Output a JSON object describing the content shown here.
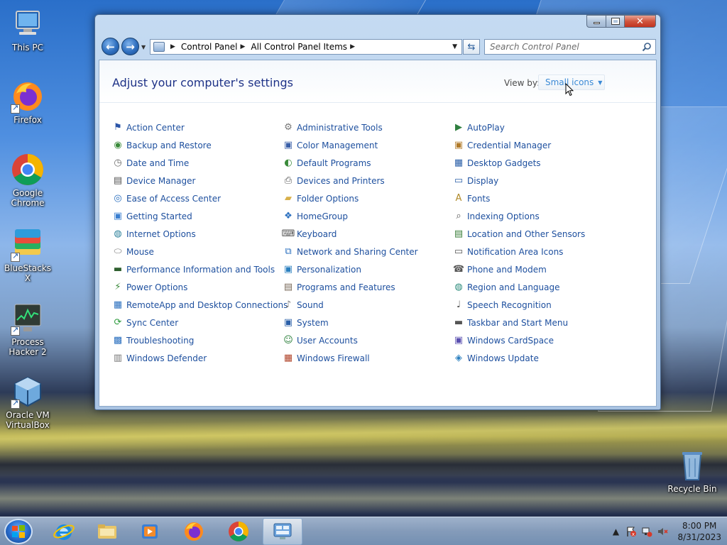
{
  "desktop": {
    "icons": [
      {
        "label": "This PC"
      },
      {
        "label": "Firefox"
      },
      {
        "label": "Google Chrome"
      },
      {
        "label": "BlueStacks X"
      },
      {
        "label": "Process Hacker 2"
      },
      {
        "label": "Oracle VM VirtualBox"
      },
      {
        "label": "Recycle Bin"
      }
    ]
  },
  "window": {
    "breadcrumb": [
      "Control Panel",
      "All Control Panel Items"
    ],
    "search_placeholder": "Search Control Panel",
    "title": "Adjust your computer's settings",
    "view_by_label": "View by:",
    "view_by_value": "Small icons",
    "columns": [
      [
        {
          "label": "Action Center",
          "icon": "flag-icon"
        },
        {
          "label": "Backup and Restore",
          "icon": "backup-icon"
        },
        {
          "label": "Date and Time",
          "icon": "clock-icon"
        },
        {
          "label": "Device Manager",
          "icon": "device-manager-icon"
        },
        {
          "label": "Ease of Access Center",
          "icon": "accessibility-icon"
        },
        {
          "label": "Getting Started",
          "icon": "getting-started-icon"
        },
        {
          "label": "Internet Options",
          "icon": "internet-icon"
        },
        {
          "label": "Mouse",
          "icon": "mouse-icon"
        },
        {
          "label": "Performance Information and Tools",
          "icon": "performance-icon"
        },
        {
          "label": "Power Options",
          "icon": "power-icon"
        },
        {
          "label": "RemoteApp and Desktop Connections",
          "icon": "remoteapp-icon"
        },
        {
          "label": "Sync Center",
          "icon": "sync-icon"
        },
        {
          "label": "Troubleshooting",
          "icon": "troubleshoot-icon"
        },
        {
          "label": "Windows Defender",
          "icon": "defender-icon"
        }
      ],
      [
        {
          "label": "Administrative Tools",
          "icon": "admin-tools-icon"
        },
        {
          "label": "Color Management",
          "icon": "color-icon"
        },
        {
          "label": "Default Programs",
          "icon": "default-programs-icon"
        },
        {
          "label": "Devices and Printers",
          "icon": "printer-icon"
        },
        {
          "label": "Folder Options",
          "icon": "folder-icon"
        },
        {
          "label": "HomeGroup",
          "icon": "homegroup-icon"
        },
        {
          "label": "Keyboard",
          "icon": "keyboard-icon"
        },
        {
          "label": "Network and Sharing Center",
          "icon": "network-icon"
        },
        {
          "label": "Personalization",
          "icon": "personalization-icon"
        },
        {
          "label": "Programs and Features",
          "icon": "programs-icon"
        },
        {
          "label": "Sound",
          "icon": "sound-icon"
        },
        {
          "label": "System",
          "icon": "system-icon"
        },
        {
          "label": "User Accounts",
          "icon": "users-icon"
        },
        {
          "label": "Windows Firewall",
          "icon": "firewall-icon"
        }
      ],
      [
        {
          "label": "AutoPlay",
          "icon": "autoplay-icon"
        },
        {
          "label": "Credential Manager",
          "icon": "credential-icon"
        },
        {
          "label": "Desktop Gadgets",
          "icon": "gadgets-icon"
        },
        {
          "label": "Display",
          "icon": "display-icon"
        },
        {
          "label": "Fonts",
          "icon": "fonts-icon"
        },
        {
          "label": "Indexing Options",
          "icon": "indexing-icon"
        },
        {
          "label": "Location and Other Sensors",
          "icon": "location-icon"
        },
        {
          "label": "Notification Area Icons",
          "icon": "notification-icon"
        },
        {
          "label": "Phone and Modem",
          "icon": "phone-icon"
        },
        {
          "label": "Region and Language",
          "icon": "globe-icon"
        },
        {
          "label": "Speech Recognition",
          "icon": "microphone-icon"
        },
        {
          "label": "Taskbar and Start Menu",
          "icon": "taskbar-icon"
        },
        {
          "label": "Windows CardSpace",
          "icon": "cardspace-icon"
        },
        {
          "label": "Windows Update",
          "icon": "update-icon"
        }
      ]
    ]
  },
  "taskbar": {
    "time": "8:00 PM",
    "date": "8/31/2023"
  },
  "colors": {
    "link": "#1d4f9e",
    "title": "#1e3287",
    "view_by_value": "#3b8ad6"
  }
}
